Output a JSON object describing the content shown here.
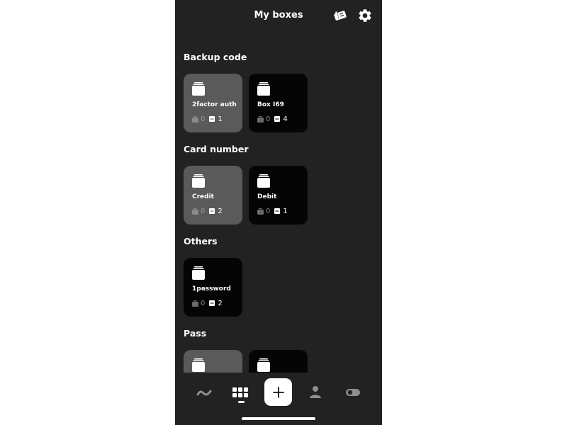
{
  "header": {
    "title": "My boxes",
    "ticket_icon": "ticket-icon",
    "settings_icon": "gear-icon"
  },
  "sections": [
    {
      "title": "Backup code",
      "cards": [
        {
          "name": "2factor auth",
          "count_a": "0",
          "count_b": "1",
          "style": "light"
        },
        {
          "name": "Box I69",
          "count_a": "0",
          "count_b": "4",
          "style": "dark"
        }
      ]
    },
    {
      "title": "Card number",
      "cards": [
        {
          "name": "Credit",
          "count_a": "0",
          "count_b": "2",
          "style": "light"
        },
        {
          "name": "Debit",
          "count_a": "0",
          "count_b": "1",
          "style": "dark"
        }
      ]
    },
    {
      "title": "Others",
      "cards": [
        {
          "name": "1password",
          "count_a": "0",
          "count_b": "2",
          "style": "dark"
        }
      ]
    },
    {
      "title": "Pass",
      "cards": [
        {
          "name": "",
          "count_a": "",
          "count_b": "",
          "style": "light"
        },
        {
          "name": "",
          "count_a": "",
          "count_b": "",
          "style": "dark"
        }
      ]
    }
  ],
  "bottom_nav": {
    "items": [
      "activity-icon",
      "grid-icon",
      "add-icon",
      "person-icon",
      "toggle-icon"
    ],
    "active": "grid-icon"
  },
  "colors": {
    "background": "#212221",
    "card_light": "#5a5a5a",
    "card_dark": "#050505",
    "text": "#ffffff"
  }
}
